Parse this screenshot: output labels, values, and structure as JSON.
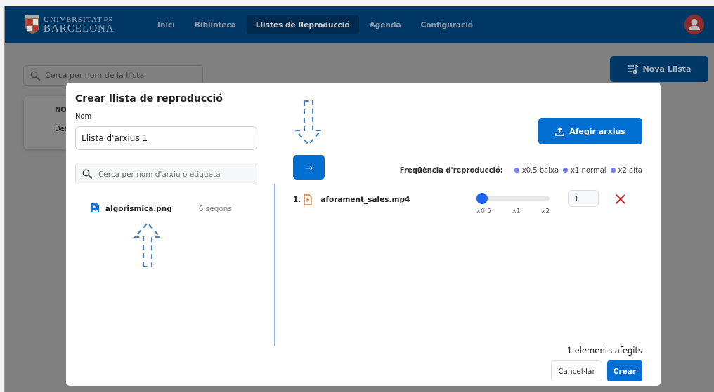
{
  "header": {
    "logo": {
      "line_1": "UNIVERSITAT",
      "line_1_suffix": "DE",
      "line_2": "BARCELONA"
    },
    "nav": [
      {
        "label": "Inici",
        "selected": false
      },
      {
        "label": "Biblioteca",
        "selected": false
      },
      {
        "label": "Llistes de Reproducció",
        "selected": true
      },
      {
        "label": "Agenda",
        "selected": false
      },
      {
        "label": "Configuració",
        "selected": false
      }
    ]
  },
  "background": {
    "search": {
      "placeholder": "Cerca per nom de la llista"
    },
    "new_list_button": "Nova Llista",
    "table": {
      "column_1": "NO",
      "cell_1": "Det"
    }
  },
  "dialog": {
    "title": "Crear llista de reproducció",
    "name_label": "Nom",
    "name_value": "Llista d'arxius 1",
    "search": {
      "placeholder": "Cerca per nom d'arxiu o etiqueta"
    },
    "files": [
      {
        "name": "algorismica.png",
        "duration": "6 segons"
      }
    ],
    "add_button": "Afegir arxius",
    "move_button": "→",
    "frequency": {
      "label": "Freqüència d'reproducció:",
      "options": [
        {
          "label": "x0.5 baixa",
          "color": "#7b7bf5"
        },
        {
          "label": "x1 normal",
          "color": "#7b7bf5"
        },
        {
          "label": "x2 alta",
          "color": "#7b7bf5"
        }
      ]
    },
    "items": [
      {
        "number": "1.",
        "name": "aforament_sales.mp4",
        "level": 0,
        "ticks": [
          "x0.5",
          "x1",
          "x2"
        ],
        "count": "1"
      }
    ],
    "summary": "1 elements afegits",
    "cancel_button": "Cancel·lar",
    "create_button": "Crear"
  }
}
